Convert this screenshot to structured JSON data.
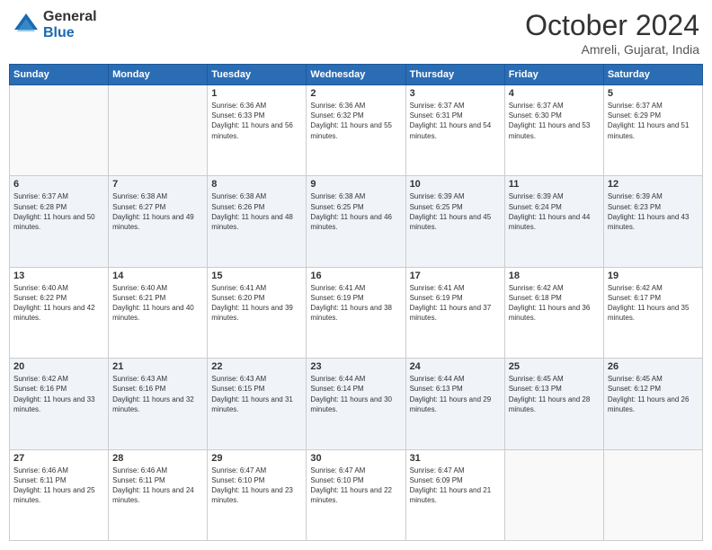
{
  "header": {
    "logo_line1": "General",
    "logo_line2": "Blue",
    "month": "October 2024",
    "location": "Amreli, Gujarat, India"
  },
  "days_of_week": [
    "Sunday",
    "Monday",
    "Tuesday",
    "Wednesday",
    "Thursday",
    "Friday",
    "Saturday"
  ],
  "weeks": [
    [
      {
        "day": "",
        "info": ""
      },
      {
        "day": "",
        "info": ""
      },
      {
        "day": "1",
        "info": "Sunrise: 6:36 AM\nSunset: 6:33 PM\nDaylight: 11 hours and 56 minutes."
      },
      {
        "day": "2",
        "info": "Sunrise: 6:36 AM\nSunset: 6:32 PM\nDaylight: 11 hours and 55 minutes."
      },
      {
        "day": "3",
        "info": "Sunrise: 6:37 AM\nSunset: 6:31 PM\nDaylight: 11 hours and 54 minutes."
      },
      {
        "day": "4",
        "info": "Sunrise: 6:37 AM\nSunset: 6:30 PM\nDaylight: 11 hours and 53 minutes."
      },
      {
        "day": "5",
        "info": "Sunrise: 6:37 AM\nSunset: 6:29 PM\nDaylight: 11 hours and 51 minutes."
      }
    ],
    [
      {
        "day": "6",
        "info": "Sunrise: 6:37 AM\nSunset: 6:28 PM\nDaylight: 11 hours and 50 minutes."
      },
      {
        "day": "7",
        "info": "Sunrise: 6:38 AM\nSunset: 6:27 PM\nDaylight: 11 hours and 49 minutes."
      },
      {
        "day": "8",
        "info": "Sunrise: 6:38 AM\nSunset: 6:26 PM\nDaylight: 11 hours and 48 minutes."
      },
      {
        "day": "9",
        "info": "Sunrise: 6:38 AM\nSunset: 6:25 PM\nDaylight: 11 hours and 46 minutes."
      },
      {
        "day": "10",
        "info": "Sunrise: 6:39 AM\nSunset: 6:25 PM\nDaylight: 11 hours and 45 minutes."
      },
      {
        "day": "11",
        "info": "Sunrise: 6:39 AM\nSunset: 6:24 PM\nDaylight: 11 hours and 44 minutes."
      },
      {
        "day": "12",
        "info": "Sunrise: 6:39 AM\nSunset: 6:23 PM\nDaylight: 11 hours and 43 minutes."
      }
    ],
    [
      {
        "day": "13",
        "info": "Sunrise: 6:40 AM\nSunset: 6:22 PM\nDaylight: 11 hours and 42 minutes."
      },
      {
        "day": "14",
        "info": "Sunrise: 6:40 AM\nSunset: 6:21 PM\nDaylight: 11 hours and 40 minutes."
      },
      {
        "day": "15",
        "info": "Sunrise: 6:41 AM\nSunset: 6:20 PM\nDaylight: 11 hours and 39 minutes."
      },
      {
        "day": "16",
        "info": "Sunrise: 6:41 AM\nSunset: 6:19 PM\nDaylight: 11 hours and 38 minutes."
      },
      {
        "day": "17",
        "info": "Sunrise: 6:41 AM\nSunset: 6:19 PM\nDaylight: 11 hours and 37 minutes."
      },
      {
        "day": "18",
        "info": "Sunrise: 6:42 AM\nSunset: 6:18 PM\nDaylight: 11 hours and 36 minutes."
      },
      {
        "day": "19",
        "info": "Sunrise: 6:42 AM\nSunset: 6:17 PM\nDaylight: 11 hours and 35 minutes."
      }
    ],
    [
      {
        "day": "20",
        "info": "Sunrise: 6:42 AM\nSunset: 6:16 PM\nDaylight: 11 hours and 33 minutes."
      },
      {
        "day": "21",
        "info": "Sunrise: 6:43 AM\nSunset: 6:16 PM\nDaylight: 11 hours and 32 minutes."
      },
      {
        "day": "22",
        "info": "Sunrise: 6:43 AM\nSunset: 6:15 PM\nDaylight: 11 hours and 31 minutes."
      },
      {
        "day": "23",
        "info": "Sunrise: 6:44 AM\nSunset: 6:14 PM\nDaylight: 11 hours and 30 minutes."
      },
      {
        "day": "24",
        "info": "Sunrise: 6:44 AM\nSunset: 6:13 PM\nDaylight: 11 hours and 29 minutes."
      },
      {
        "day": "25",
        "info": "Sunrise: 6:45 AM\nSunset: 6:13 PM\nDaylight: 11 hours and 28 minutes."
      },
      {
        "day": "26",
        "info": "Sunrise: 6:45 AM\nSunset: 6:12 PM\nDaylight: 11 hours and 26 minutes."
      }
    ],
    [
      {
        "day": "27",
        "info": "Sunrise: 6:46 AM\nSunset: 6:11 PM\nDaylight: 11 hours and 25 minutes."
      },
      {
        "day": "28",
        "info": "Sunrise: 6:46 AM\nSunset: 6:11 PM\nDaylight: 11 hours and 24 minutes."
      },
      {
        "day": "29",
        "info": "Sunrise: 6:47 AM\nSunset: 6:10 PM\nDaylight: 11 hours and 23 minutes."
      },
      {
        "day": "30",
        "info": "Sunrise: 6:47 AM\nSunset: 6:10 PM\nDaylight: 11 hours and 22 minutes."
      },
      {
        "day": "31",
        "info": "Sunrise: 6:47 AM\nSunset: 6:09 PM\nDaylight: 11 hours and 21 minutes."
      },
      {
        "day": "",
        "info": ""
      },
      {
        "day": "",
        "info": ""
      }
    ]
  ]
}
